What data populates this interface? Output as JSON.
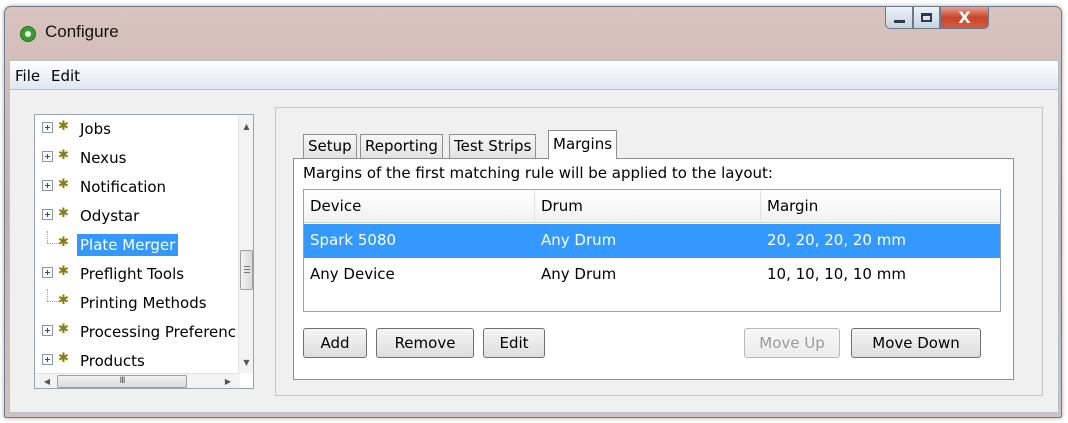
{
  "window": {
    "title": "Configure",
    "controls": {
      "close_glyph": "X"
    }
  },
  "menubar": {
    "items": [
      "File",
      "Edit"
    ]
  },
  "tree": {
    "items": [
      {
        "label": "Jobs",
        "expandable": true
      },
      {
        "label": "Nexus",
        "expandable": true
      },
      {
        "label": "Notification",
        "expandable": true
      },
      {
        "label": "Odystar",
        "expandable": true
      },
      {
        "label": "Plate Merger",
        "expandable": false,
        "selected": true
      },
      {
        "label": "Preflight Tools",
        "expandable": true
      },
      {
        "label": "Printing Methods",
        "expandable": false
      },
      {
        "label": "Processing Preferenc",
        "expandable": true
      },
      {
        "label": "Products",
        "expandable": true
      }
    ],
    "scrollbar_grip": "III"
  },
  "tabs": [
    {
      "label": "Setup",
      "active": false
    },
    {
      "label": "Reporting",
      "active": false
    },
    {
      "label": "Test Strips",
      "active": false
    },
    {
      "label": "Margins",
      "active": true
    }
  ],
  "margins": {
    "description": "Margins of the first matching rule will be applied to the layout:",
    "columns": [
      "Device",
      "Drum",
      "Margin"
    ],
    "rows": [
      {
        "device": "Spark 5080",
        "drum": "Any Drum",
        "margin": "20, 20, 20, 20 mm",
        "selected": true
      },
      {
        "device": "Any Device",
        "drum": "Any Drum",
        "margin": "10, 10, 10, 10 mm",
        "selected": false
      }
    ],
    "buttons": {
      "add": "Add",
      "remove": "Remove",
      "edit": "Edit",
      "move_up": "Move Up",
      "move_down": "Move Down"
    },
    "move_up_enabled": false
  },
  "colors": {
    "selection": "#3399ff",
    "icon_gear": "#8b7a12"
  }
}
